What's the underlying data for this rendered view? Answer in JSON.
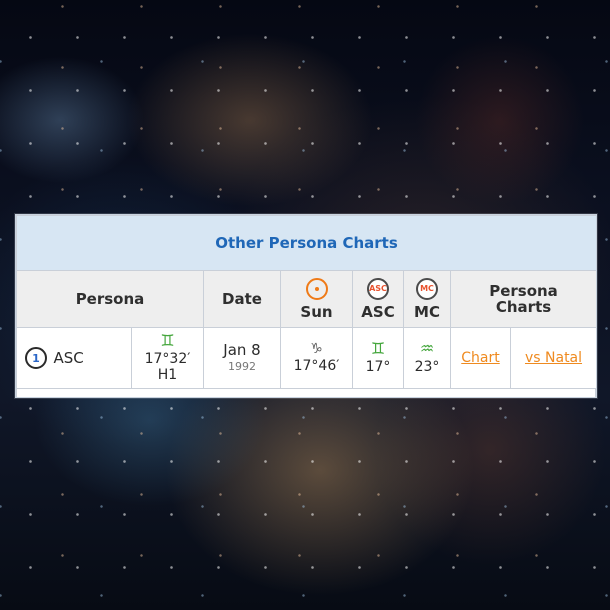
{
  "table": {
    "title": "Other Persona Charts",
    "headers": {
      "persona": "Persona",
      "date": "Date",
      "sun": "Sun",
      "asc": "ASC",
      "mc": "MC",
      "persona_charts": "Persona\nCharts"
    },
    "header_symbols": {
      "asc": "ASC",
      "mc": "MC"
    },
    "rows": [
      {
        "index": "1",
        "persona": "ASC",
        "persona_sign": "♊",
        "persona_position": "17°32′",
        "persona_house": "H1",
        "date_main": "Jan 8",
        "date_year": "1992",
        "sun_sign": "♑",
        "sun_value": "17°46′",
        "asc_sign": "♊",
        "asc_value": "17°",
        "mc_sign": "♒",
        "mc_value": "23°",
        "chart_link": "Chart",
        "natal_link": "vs Natal"
      }
    ]
  }
}
